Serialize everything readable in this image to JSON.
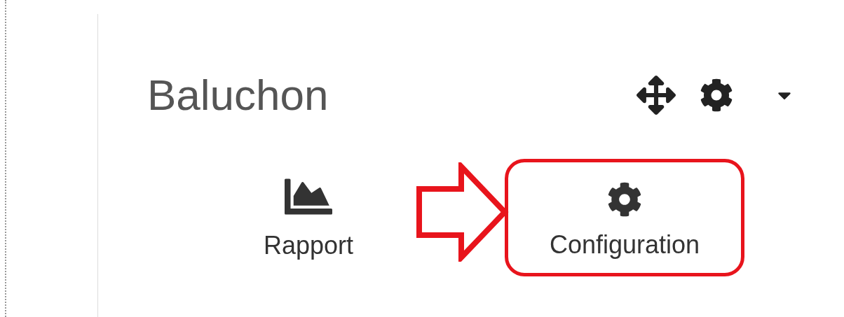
{
  "title": "Baluchon",
  "tiles": [
    {
      "label": "Rapport",
      "kind": "chart",
      "highlighted": false
    },
    {
      "label": "Configuration",
      "kind": "gear",
      "highlighted": true
    }
  ]
}
